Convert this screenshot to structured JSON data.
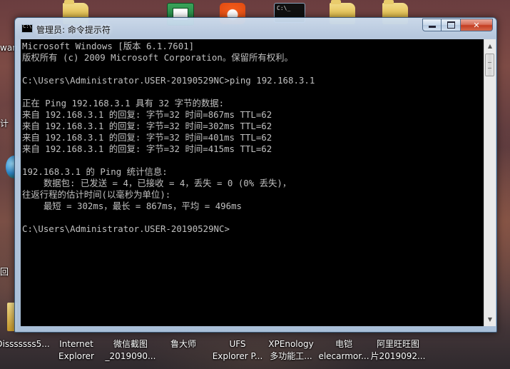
{
  "window": {
    "title": "管理员: 命令提示符",
    "minimize_glyph": "",
    "close_glyph": "✕"
  },
  "console": {
    "lines": [
      "Microsoft Windows [版本 6.1.7601]",
      "版权所有 (c) 2009 Microsoft Corporation。保留所有权利。",
      "",
      "C:\\Users\\Administrator.USER-20190529NC>ping 192.168.3.1",
      "",
      "正在 Ping 192.168.3.1 具有 32 字节的数据:",
      "来自 192.168.3.1 的回复: 字节=32 时间=867ms TTL=62",
      "来自 192.168.3.1 的回复: 字节=32 时间=302ms TTL=62",
      "来自 192.168.3.1 的回复: 字节=32 时间=401ms TTL=62",
      "来自 192.168.3.1 的回复: 字节=32 时间=415ms TTL=62",
      "",
      "192.168.3.1 的 Ping 统计信息:",
      "    数据包: 已发送 = 4，已接收 = 4，丢失 = 0 (0% 丢失)，",
      "往返行程的估计时间(以毫秒为单位):",
      "    最短 = 302ms，最长 = 867ms，平均 = 496ms",
      "",
      "C:\\Users\\Administrator.USER-20190529NC>"
    ]
  },
  "desktop": {
    "edge_labels": [
      "wan",
      "计",
      "回"
    ],
    "icons": [
      {
        "line1": "Disssssss5...",
        "line2": ""
      },
      {
        "line1": "Internet",
        "line2": "Explorer"
      },
      {
        "line1": "微信截图",
        "line2": "_2019090..."
      },
      {
        "line1": "鲁大师",
        "line2": ""
      },
      {
        "line1": "UFS",
        "line2": "Explorer P..."
      },
      {
        "line1": "XPEnology",
        "line2": "多功能工..."
      },
      {
        "line1": "电铠",
        "line2": "elecarmor..."
      },
      {
        "line1": "阿里旺旺图",
        "line2": "片2019092..."
      }
    ]
  },
  "colors": {
    "console_bg": "#000000",
    "console_fg": "#c0c0c0",
    "close_button": "#c43d21"
  }
}
